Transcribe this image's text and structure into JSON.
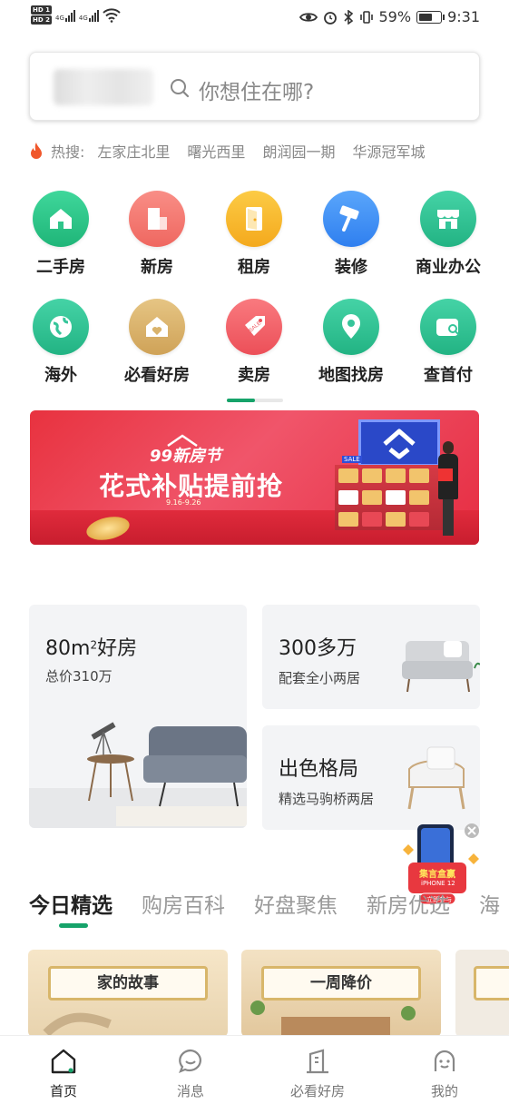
{
  "status_bar": {
    "sim1": "HD 1",
    "sim2": "HD 2",
    "net1": "4G",
    "net2": "4G",
    "battery": "59%",
    "time": "9:31"
  },
  "search": {
    "placeholder": "你想住在哪?"
  },
  "hot_search": {
    "label": "热搜:",
    "keywords": [
      "左家庄北里",
      "曙光西里",
      "朗润园一期",
      "华源冠军城"
    ]
  },
  "categories": [
    {
      "label": "二手房",
      "icon": "house-icon",
      "color": "#2fc58a"
    },
    {
      "label": "新房",
      "icon": "building-icon",
      "color": "#f57a72"
    },
    {
      "label": "租房",
      "icon": "door-icon",
      "color": "#f8b92e"
    },
    {
      "label": "装修",
      "icon": "brush-icon",
      "color": "#3d8ff5"
    },
    {
      "label": "商业办公",
      "icon": "shop-icon",
      "color": "#35c59a"
    },
    {
      "label": "海外",
      "icon": "globe-icon",
      "color": "#35c59a"
    },
    {
      "label": "必看好房",
      "icon": "heart-house-icon",
      "color": "#d9b36c"
    },
    {
      "label": "卖房",
      "icon": "sale-tag-icon",
      "color": "#f26067"
    },
    {
      "label": "地图找房",
      "icon": "map-pin-icon",
      "color": "#35c59a"
    },
    {
      "label": "查首付",
      "icon": "wallet-search-icon",
      "color": "#35c59a"
    }
  ],
  "pager": {
    "progress": 0.5
  },
  "banner": {
    "badge": "99新房节",
    "headline": "花式补贴提前抢",
    "dates": "9.16-9.26",
    "sale": "SALE"
  },
  "cards": {
    "card1": {
      "title": "80m",
      "title_sup": "2",
      "title_suffix": "好房",
      "subtitle": "总价310万"
    },
    "card2": {
      "title": "300多万",
      "subtitle": "配套全小两居"
    },
    "card3": {
      "title": "出色格局",
      "subtitle": "精选马驹桥两居"
    }
  },
  "tabs": [
    "今日精选",
    "购房百科",
    "好盘聚焦",
    "新房优选",
    "海"
  ],
  "thumbs": [
    "家的故事",
    "一周降价"
  ],
  "promo": {
    "title": "集言盒赢",
    "product": "iPHONE 12",
    "cta": "立即参与"
  },
  "nav": [
    {
      "label": "首页",
      "icon": "home-icon",
      "active": true
    },
    {
      "label": "消息",
      "icon": "message-icon",
      "active": false
    },
    {
      "label": "必看好房",
      "icon": "must-see-icon",
      "active": false
    },
    {
      "label": "我的",
      "icon": "profile-icon",
      "active": false
    }
  ],
  "accent": "#16a36a"
}
